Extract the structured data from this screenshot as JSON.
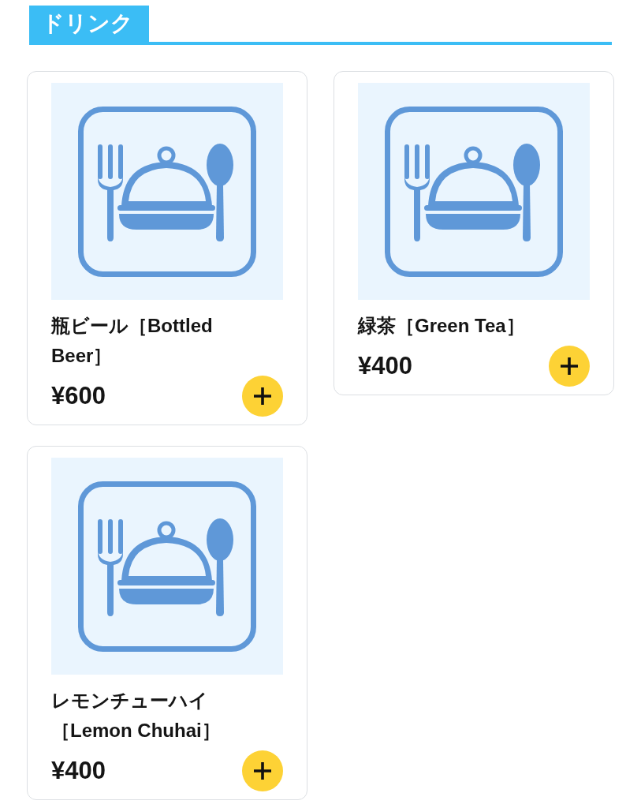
{
  "section": {
    "title": "ドリンク"
  },
  "items": [
    {
      "name": "瓶ビール［Bottled Beer］",
      "price": "¥600"
    },
    {
      "name": "緑茶［Green Tea］",
      "price": "¥400"
    },
    {
      "name": "レモンチューハイ［Lemon Chuhai］",
      "price": "¥400"
    }
  ]
}
